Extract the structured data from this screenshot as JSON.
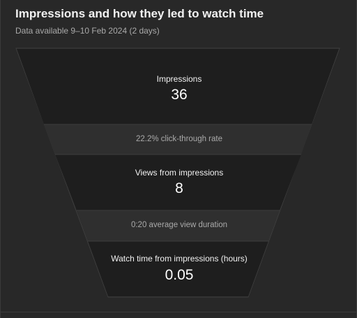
{
  "card": {
    "title": "Impressions and how they led to watch time",
    "subtitle": "Data available 9–10 Feb 2024 (2 days)"
  },
  "funnel": {
    "impressions": {
      "label": "Impressions",
      "value": "36"
    },
    "ctr": {
      "text": "22.2% click-through rate"
    },
    "views": {
      "label": "Views from impressions",
      "value": "8"
    },
    "avd": {
      "text": "0:20 average view duration"
    },
    "watch_time": {
      "label": "Watch time from impressions (hours)",
      "value": "0.05"
    }
  },
  "colors": {
    "card_bg": "#282828",
    "stage_bg": "#1e1e1e",
    "band_bg": "#2f2f2f",
    "outline": "#3e3e3e",
    "text_primary": "#f1f1f1",
    "text_secondary": "#aaaaaa"
  }
}
